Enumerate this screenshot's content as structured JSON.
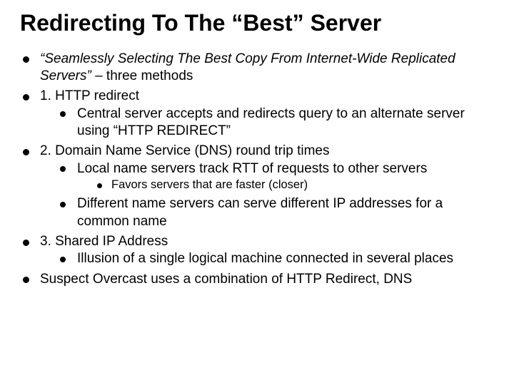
{
  "title": "Redirecting To The “Best” Server",
  "items": [
    {
      "text_pre": "“Seamlessly Selecting The Best Copy From Internet-Wide Replicated Servers”",
      "text_post": " – three methods"
    },
    {
      "text": "1. HTTP redirect",
      "sub": [
        {
          "text": "Central server accepts and redirects query to an alternate server using “HTTP REDIRECT”"
        }
      ]
    },
    {
      "text": "2. Domain Name Service (DNS) round trip times",
      "sub": [
        {
          "text": "Local name servers track RTT of requests to other servers",
          "sub": [
            {
              "text": "Favors servers that are faster (closer)"
            }
          ]
        },
        {
          "text": "Different name servers can serve different IP addresses for a common name"
        }
      ]
    },
    {
      "text": "3. Shared IP Address",
      "sub": [
        {
          "text": "Illusion of a single logical machine connected in several places"
        }
      ]
    },
    {
      "text": "Suspect Overcast uses a combination of HTTP Redirect, DNS"
    }
  ]
}
